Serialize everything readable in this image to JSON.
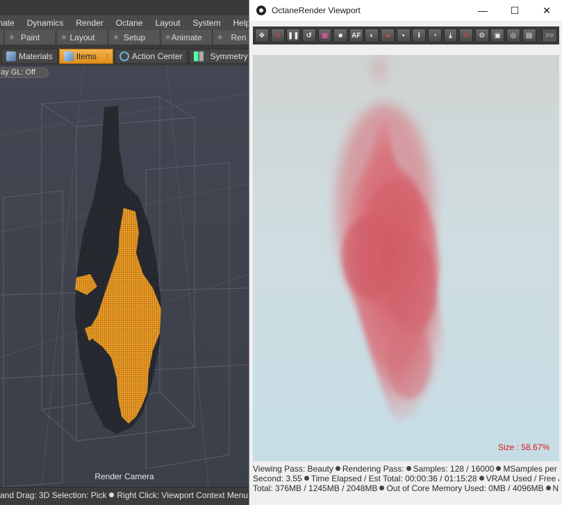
{
  "modo": {
    "menu": [
      "mate",
      "Dynamics",
      "Render",
      "Octane",
      "Layout",
      "System",
      "Help"
    ],
    "layout_tabs": [
      "Paint",
      "Layout",
      "Setup",
      "Animate",
      "Ren"
    ],
    "sub_tabs": {
      "materials": "Materials",
      "items": "Items",
      "action_center": "Action Center",
      "symmetry": "Symmetry"
    },
    "viewport": {
      "gl_toggle": "ay GL: Off",
      "camera_label": "Render Camera"
    },
    "status": {
      "left": "and Drag: 3D Selection: Pick",
      "right": "Right Click: Viewport Context Menu (popup"
    },
    "colors": {
      "highlight": "#e8951f",
      "selection": "#f0a02a"
    }
  },
  "octane": {
    "title": "OctaneRender Viewport",
    "window_buttons": {
      "minimize": "—",
      "maximize": "☐",
      "close": "✕"
    },
    "toolbar_icons": [
      "reset-camera-icon",
      "stop-render-icon",
      "pause-render-icon",
      "restart-render-icon",
      "color-grid-icon",
      "region-render-icon",
      "af-focus-icon",
      "clay-mode-icon",
      "color-picker-icon",
      "lock-icon",
      "info-icon",
      "picker-icon",
      "save-icon",
      "delete-icon",
      "settings-icon",
      "export-icon",
      "camera-icon",
      "layers-icon"
    ],
    "toolbar_labels": {
      "af-focus-icon": "AF"
    },
    "more_label": ">>",
    "size_label": "Size : 58.67%",
    "status": {
      "line1a": "Viewing Pass: Beauty",
      "line1b": "Rendering Pass:",
      "line1c": "Samples: 128  / 16000",
      "line1d": "MSamples per",
      "line2a": "Second: 3.55",
      "line2b": "Time Elapsed / Est Total: 00:00:36 / 01:15:28",
      "line2c": "VRAM Used / Free /",
      "line3a": "Total: 376MB / 1245MB / 2048MB",
      "line3b": "Out of Core Memory Used: 0MB / 4096MB",
      "line3c": "Numbe ..."
    },
    "colors": {
      "smoke": "#d8646e",
      "size_label": "#e2141a"
    }
  }
}
